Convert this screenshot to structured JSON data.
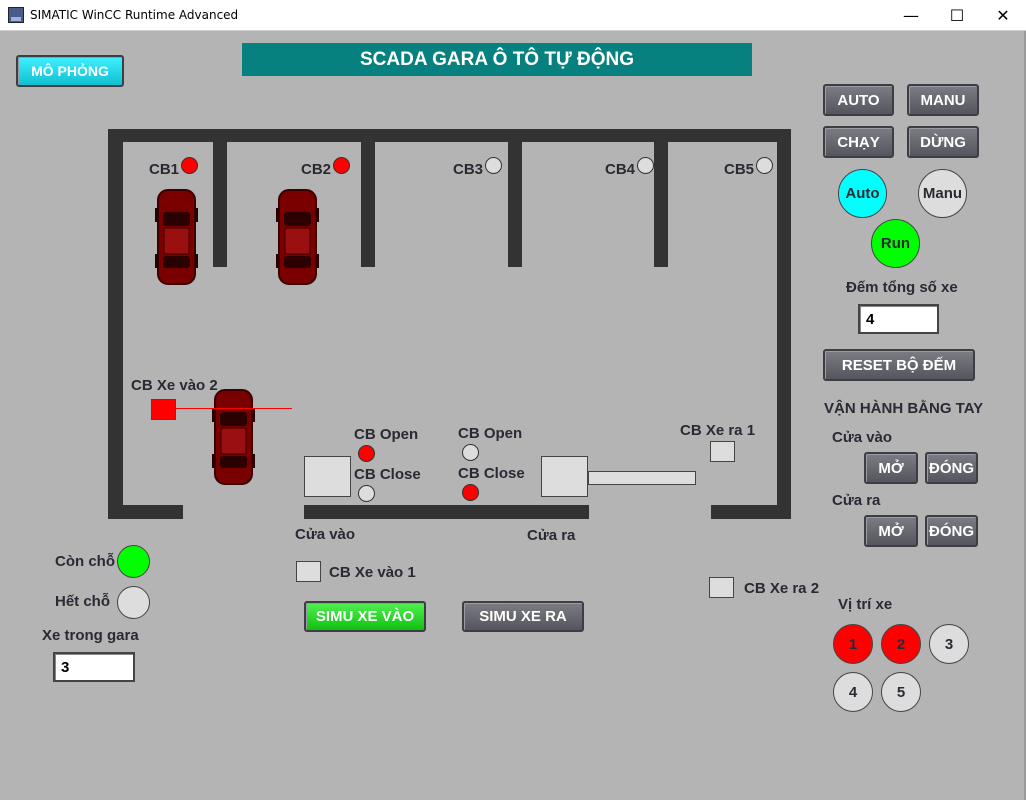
{
  "window": {
    "title": "SIMATIC WinCC Runtime Advanced",
    "minimize": "—",
    "maximize": "☐",
    "close": "✕"
  },
  "header": {
    "title": "SCADA GARA Ô TÔ TỰ ĐỘNG",
    "simulate_button": "MÔ PHỎNG"
  },
  "slots": [
    {
      "label": "CB1",
      "occupied": true
    },
    {
      "label": "CB2",
      "occupied": true
    },
    {
      "label": "CB3",
      "occupied": false
    },
    {
      "label": "CB4",
      "occupied": false
    },
    {
      "label": "CB5",
      "occupied": false
    }
  ],
  "sensors": {
    "entry2": "CB Xe vào 2",
    "entry1": "CB Xe vào 1",
    "exit1": "CB Xe ra 1",
    "exit2": "CB Xe ra 2",
    "in_open": "CB Open",
    "in_close": "CB Close",
    "out_open": "CB Open",
    "out_close": "CB Close"
  },
  "doors": {
    "entry": "Cửa vào",
    "exit": "Cửa ra"
  },
  "status": {
    "available_label": "Còn chỗ",
    "full_label": "Hết chỗ",
    "cars_in_label": "Xe trong gara",
    "cars_in_value": "3"
  },
  "sim_buttons": {
    "in": "SIMU XE VÀO",
    "out": "SIMU XE RA"
  },
  "controls": {
    "auto": "AUTO",
    "manu": "MANU",
    "run": "CHẠY",
    "stop": "DỪNG",
    "ind_auto": "Auto",
    "ind_manu": "Manu",
    "ind_run": "Run",
    "count_label": "Đếm tổng số xe",
    "count_value": "4",
    "reset": "RESET BỘ ĐẾM",
    "manual_title": "VẬN HÀNH BẰNG TAY",
    "entry_door": "Cửa vào",
    "exit_door": "Cửa ra",
    "open": "MỞ",
    "close": "ĐÓNG",
    "positions_label": "Vị trí xe",
    "positions": [
      "1",
      "2",
      "3",
      "4",
      "5"
    ],
    "positions_occupied": [
      true,
      true,
      false,
      false,
      false
    ]
  },
  "colors": {
    "teal_title": "#078080",
    "indicator_red": "#ff0000",
    "indicator_green": "#00ff00",
    "indicator_cyan": "#00ffff",
    "car_body": "#7a0000"
  }
}
